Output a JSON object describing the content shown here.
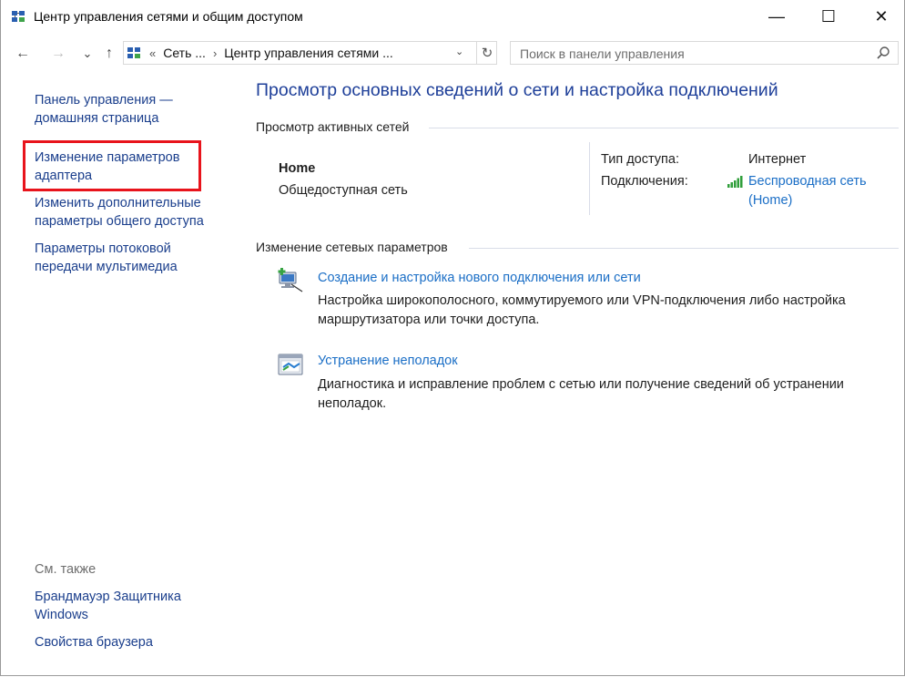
{
  "window": {
    "title": "Центр управления сетями и общим доступом",
    "minimize": "—",
    "maximize": "☐",
    "close": "✕"
  },
  "nav": {
    "back": "←",
    "forward": "→",
    "recent": "⌄",
    "up": "↑"
  },
  "address": {
    "overflow": "«",
    "crumbs": [
      "Сеть ...",
      "Центр управления сетями ..."
    ],
    "separator": "›",
    "dropdown": "⌄",
    "refresh": "↻"
  },
  "search": {
    "placeholder": "Поиск в панели управления"
  },
  "sidebar": {
    "home_line1": "Панель управления —",
    "home_line2": "домашняя страница",
    "adapter_line1": "Изменение параметров",
    "adapter_line2": "адаптера",
    "sharing_line1": "Изменить дополнительные",
    "sharing_line2": "параметры общего доступа",
    "media_line1": "Параметры потоковой",
    "media_line2": "передачи мультимедиа",
    "see_also": "См. также",
    "firewall_line1": "Брандмауэр Защитника",
    "firewall_line2": "Windows",
    "browser": "Свойства браузера"
  },
  "main": {
    "heading": "Просмотр основных сведений о сети и настройка подключений",
    "active_networks": "Просмотр активных сетей",
    "network_name": "Home",
    "network_type": "Общедоступная сеть",
    "access_type_label": "Тип доступа:",
    "access_type_value": "Интернет",
    "connections_label": "Подключения:",
    "connection_line1": "Беспроводная сеть",
    "connection_line2": "(Home)",
    "change_settings": "Изменение сетевых параметров",
    "task1_link": "Создание и настройка нового подключения или сети",
    "task1_desc1": "Настройка широкополосного, коммутируемого или VPN-подключения либо настройка",
    "task1_desc2": "маршрутизатора или точки доступа.",
    "task2_link": "Устранение неполадок",
    "task2_desc1": "Диагностика и исправление проблем с сетью или получение сведений об устранении",
    "task2_desc2": "неполадок."
  },
  "colors": {
    "link": "#1a3e8c",
    "heading": "#1e3f99",
    "highlight": "#e8141c",
    "signal": "#2f9e3a"
  }
}
